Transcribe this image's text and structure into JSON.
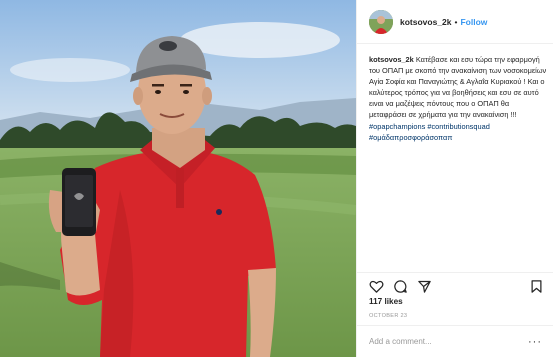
{
  "post": {
    "username": "kotsovos_2k",
    "separator": "•",
    "follow_label": "Follow"
  },
  "caption": {
    "username": "kotsovos_2k",
    "text": "Κατέβασε και εσυ τώρα την εφαρμογή του ΟΠΑΠ με σκοπό την ανακαίνιση των νοσοκομείων Αγία Σοφία και Παναγιώτης & Αγλαΐα Κυριακού ! Και ο καλύτερος τρόπος για να βοηθήσεις και εσυ σε αυτό ειναι να μαζέψεις πόντους που ο ΟΠΑΠ θα μεταφράσει σε χρήματα για την ανακαίνιση !!! ",
    "hashtags": [
      "#opapchampions",
      "#contributionsquad",
      "#ομάδαπροσφοράσοπαπ"
    ]
  },
  "actions": {
    "like_icon": "heart-icon",
    "comment_icon": "comment-bubble-icon",
    "share_icon": "share-icon",
    "save_icon": "bookmark-icon"
  },
  "likes": "117 likes",
  "date": "OCTOBER 23",
  "comment_box": {
    "placeholder": "Add a comment...",
    "more_label": "···"
  },
  "colors": {
    "link": "#3897f0",
    "hashtag": "#003569",
    "shirt": "#d7262b",
    "grass": "#7fa35a"
  }
}
